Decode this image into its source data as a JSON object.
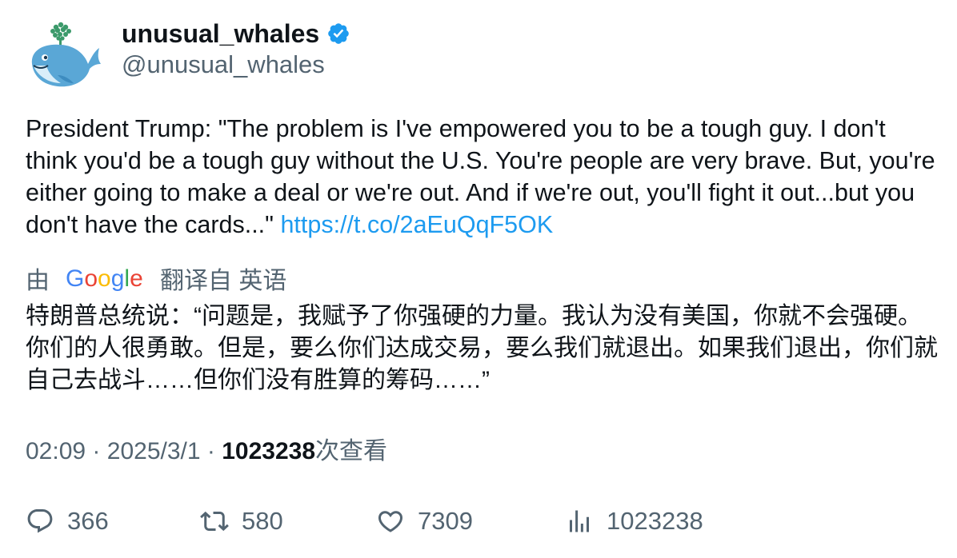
{
  "author": {
    "display_name": "unusual_whales",
    "handle": "@unusual_whales",
    "verified": true,
    "avatar_icon": "whale-icon",
    "verified_icon": "verified-badge-icon"
  },
  "tweet": {
    "text": "President Trump: \"The problem is I've empowered you to be a tough guy. I don't think you'd be a tough guy without the U.S. You're people are very brave. But, you're either going to make a deal or we're out. And if we're out, you'll fight it out...but you don't have the cards...\" ",
    "link": "https://t.co/2aEuQqF5OK"
  },
  "translation": {
    "by_label": "由",
    "provider": "Google",
    "from_label": "翻译自 英语",
    "text": "特朗普总统说：“问题是，我赋予了你强硬的力量。我认为没有美国，你就不会强硬。你们的人很勇敢。但是，要么你们达成交易，要么我们就退出。如果我们退出，你们就自己去战斗……但你们没有胜算的筹码……”"
  },
  "meta": {
    "time": "02:09",
    "separator": "·",
    "date": "2025/3/1",
    "views_count": "1023238",
    "views_label": "次查看"
  },
  "actions": {
    "replies": "366",
    "retweets": "580",
    "likes": "7309",
    "views": "1023238"
  },
  "colors": {
    "link": "#1d9bf0",
    "secondary_text": "#536471",
    "primary_text": "#0f1419",
    "verified": "#1d9bf0"
  }
}
